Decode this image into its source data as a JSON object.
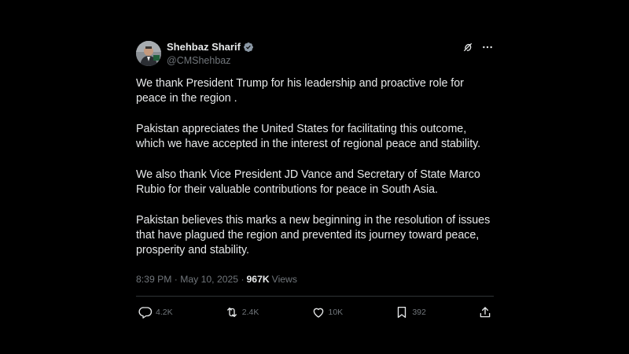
{
  "author": {
    "display_name": "Shehbaz Sharif",
    "handle": "@CMShehbaz",
    "verified": true
  },
  "icons": {
    "verified": "verified-badge-icon",
    "grok": "grok-icon",
    "more": "more-options-icon",
    "reply": "reply-icon",
    "repost": "repost-icon",
    "like": "like-icon",
    "bookmark": "bookmark-icon",
    "share": "share-icon"
  },
  "tweet": {
    "paragraphs": [
      "We thank President Trump for his leadership and proactive role for peace in the region .",
      "Pakistan appreciates the United States for facilitating this outcome, which we have accepted in the interest of regional peace and stability.",
      "We also thank Vice President JD Vance and Secretary of State Marco Rubio for their valuable contributions for peace in South Asia.",
      "Pakistan believes this marks a new beginning in the resolution of issues that have plagued the region and prevented its journey toward peace, prosperity and stability."
    ],
    "timestamp": "8:39 PM · May 10, 2025 ·",
    "views_count": "967K",
    "views_label": "Views"
  },
  "engagement": {
    "replies": "4.2K",
    "reposts": "2.4K",
    "likes": "10K",
    "bookmarks": "392"
  },
  "colors": {
    "background": "#000000",
    "text_primary": "#e7e9ea",
    "text_secondary": "#71767b",
    "divider": "#2f3336",
    "verified": "#1d9bf0"
  }
}
